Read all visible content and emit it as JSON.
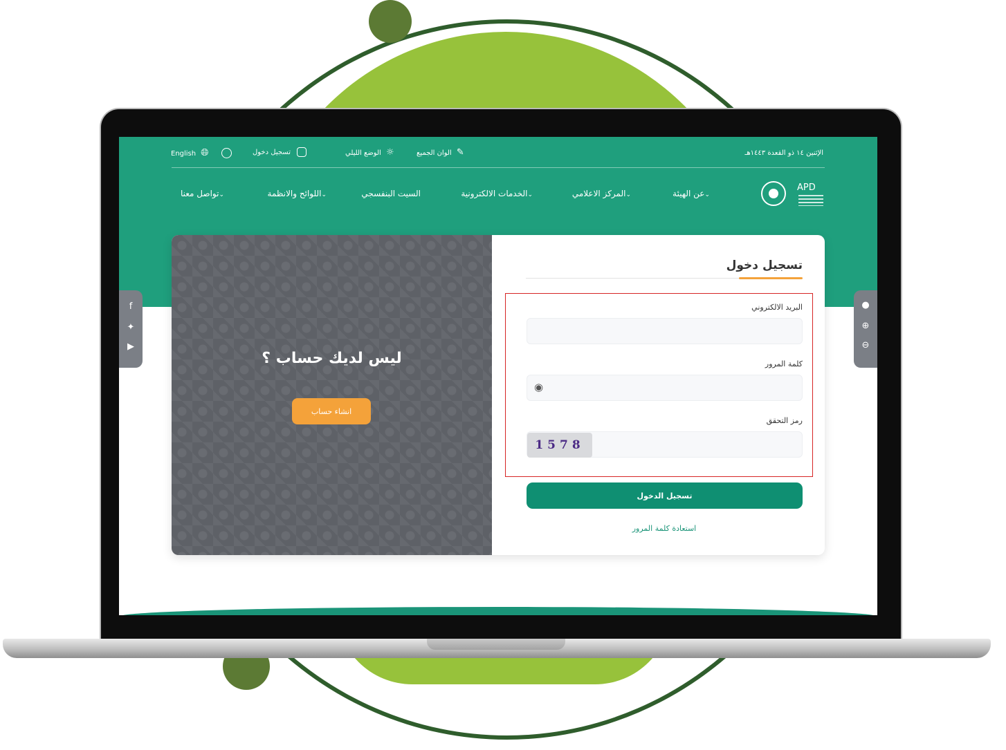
{
  "topbar": {
    "date": "الإثنين ١٤ ذو القعدة ١٤٤٣هـ",
    "colors_label": "الوان الجميع",
    "night_mode_label": "الوضع الليلي",
    "login_label": "تسجيل دخول",
    "language_label": "English"
  },
  "nav": {
    "items": [
      {
        "label": "عن الهيئة",
        "has_dropdown": true
      },
      {
        "label": "المركز الاعلامي",
        "has_dropdown": true
      },
      {
        "label": "الخدمات الالكترونية",
        "has_dropdown": true
      },
      {
        "label": "السيت البنفسجي",
        "has_dropdown": false
      },
      {
        "label": "اللوائح والانظمة",
        "has_dropdown": true
      },
      {
        "label": "تواصل معنا",
        "has_dropdown": true
      }
    ]
  },
  "logo": {
    "text": "APD"
  },
  "signup_panel": {
    "heading": "ليس لديك حساب ؟",
    "create_button": "انشاء حساب"
  },
  "login_form": {
    "title": "تسجيل دخول",
    "email_label": "البريد الالكتروني",
    "email_value": "",
    "password_label": "كلمة المرور",
    "password_value": "",
    "captcha_label": "رمز التحقق",
    "captcha_code": "1578",
    "captcha_value": "",
    "submit_label": "تسجيل الدخول",
    "forgot_link": "استعادة كلمة المرور"
  },
  "colors": {
    "brand_green": "#1f9f7d",
    "button_green": "#0f8f72",
    "accent_orange": "#f4a23a",
    "highlight_red": "#d62424"
  }
}
